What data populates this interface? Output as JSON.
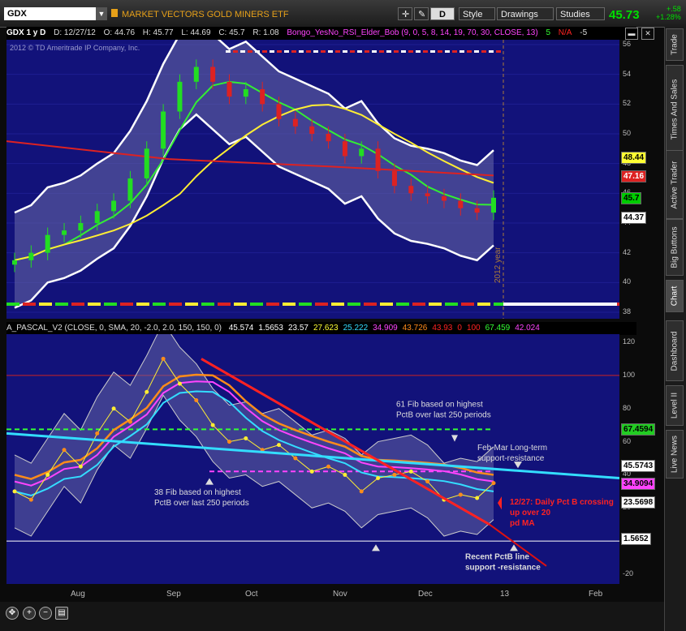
{
  "toolbar": {
    "symbol": "GDX",
    "symbol_name": "MARKET VECTORS GOLD MINERS ETF",
    "d_button": "D",
    "style_label": "Style",
    "drawings_label": "Drawings",
    "studies_label": "Studies",
    "last_price": "45.73",
    "net_change": "+.58",
    "pct_change": "+1.28%"
  },
  "title_row": {
    "symbol_period": "GDX 1 y D",
    "date": "D: 12/27/12",
    "open": "O: 44.76",
    "high": "H: 45.77",
    "low": "L: 44.69",
    "close": "C: 45.7",
    "range": "R: 1.08",
    "study": "Bongo_YesNo_RSI_Elder_Bob (9, 0, 5, 8, 14, 19, 70, 30, CLOSE, 13)",
    "study_val": "5",
    "na": "N/A",
    "neg": "-5",
    "copyright": "2012 © TD Ameritrade IP Company, Inc.",
    "year_marker": "2012 year"
  },
  "lower_title": {
    "study": "A_PASCAL_V2 (CLOSE, 0, SMA, 20, -2.0, 2.0, 150, 150, 0)",
    "values": [
      {
        "text": "45.574",
        "color": "#ffffff"
      },
      {
        "text": "1.5653",
        "color": "#ffffff"
      },
      {
        "text": "23.57",
        "color": "#ffffff"
      },
      {
        "text": "27.623",
        "color": "#ffff33"
      },
      {
        "text": "25.222",
        "color": "#33ddff"
      },
      {
        "text": "34.909",
        "color": "#ff44ff"
      },
      {
        "text": "43.726",
        "color": "#ff8c1a"
      },
      {
        "text": "43.93",
        "color": "#ff2222"
      },
      {
        "text": "0",
        "color": "#ff2222"
      },
      {
        "text": "100",
        "color": "#ff2222"
      },
      {
        "text": "67.459",
        "color": "#33ff33"
      },
      {
        "text": "42.024",
        "color": "#ff44ff"
      }
    ]
  },
  "side_tabs": [
    "Trade",
    "Times And Sales",
    "Active Trader",
    "Big Buttons",
    "Chart",
    "Dashboard",
    "Level II",
    "Live News"
  ],
  "chart_data": [
    {
      "type": "candlestick",
      "title": "GDX 1 y D",
      "x_labels": [
        "Aug",
        "Sep",
        "Oct",
        "Nov",
        "Dec",
        "13",
        "Feb"
      ],
      "ylim": [
        38,
        56
      ],
      "y_ticks": [
        38,
        40,
        42,
        44,
        46,
        48,
        50,
        52,
        54,
        56
      ],
      "series": [
        {
          "name": "close",
          "values": [
            41.5,
            42.0,
            43.2,
            43.5,
            44.0,
            44.8,
            45.5,
            47.0,
            49.0,
            51.5,
            53.5,
            54.5,
            53.5,
            52.5,
            53.0,
            52.0,
            51.0,
            50.5,
            50.0,
            49.5,
            48.5,
            49.0,
            47.5,
            46.5,
            46.0,
            45.8,
            45.5,
            45.0,
            44.7,
            45.7
          ]
        }
      ],
      "price_tags": [
        {
          "text": "48.44",
          "bg": "#ffff33",
          "fg": "#000000"
        },
        {
          "text": "47.16",
          "bg": "#dd2222",
          "fg": "#ffffff"
        },
        {
          "text": "45.7",
          "bg": "#00cc00",
          "fg": "#000000"
        },
        {
          "text": "44.37",
          "bg": "#ffffff",
          "fg": "#000000"
        }
      ]
    },
    {
      "type": "line",
      "title": "A_PASCAL_V2",
      "x_labels": [
        "Aug",
        "Sep",
        "Oct",
        "Nov",
        "Dec",
        "13",
        "Feb"
      ],
      "ylim": [
        -20,
        120
      ],
      "y_ticks": [
        -20,
        0,
        20,
        40,
        60,
        80,
        100,
        120
      ],
      "horizontal_levels": {
        "upper": 100,
        "lower": 0
      },
      "series": [
        {
          "name": "PctB",
          "values": [
            30,
            25,
            40,
            55,
            45,
            65,
            80,
            72,
            90,
            110,
            95,
            85,
            70,
            60,
            62,
            55,
            58,
            50,
            42,
            45,
            40,
            30,
            38,
            40,
            42,
            36,
            25,
            28,
            26,
            35
          ]
        }
      ],
      "price_tags": [
        {
          "text": "67.4594",
          "bg": "#22cc22",
          "fg": "#000000"
        },
        {
          "text": "45.5743",
          "bg": "#ffffff",
          "fg": "#000000"
        },
        {
          "text": "34.9094",
          "bg": "#ff44ff",
          "fg": "#000000"
        },
        {
          "text": "23.5698",
          "bg": "#ffffff",
          "fg": "#000000"
        },
        {
          "text": "1.5652",
          "bg": "#ffffff",
          "fg": "#000000"
        }
      ],
      "annotations": [
        "61 Fib based on highest PctB over last 250 periods",
        "Feb-Mar Long-term support-resistance",
        "38 Fib based on highest PctB over last 250 periods",
        "12/27:  Daily Pct B crossing up over 20 pd MA",
        "Recent PctB line support -resistance"
      ]
    }
  ],
  "colors": {
    "panel_bg": "#12127a",
    "accent_green": "#00e000",
    "red": "#ff2222"
  }
}
